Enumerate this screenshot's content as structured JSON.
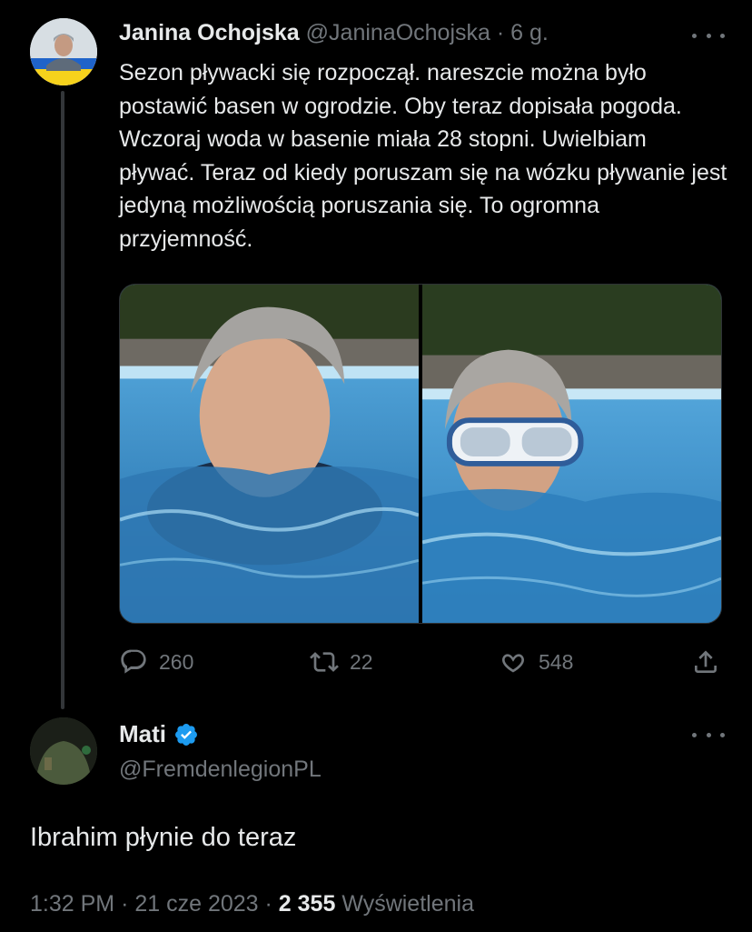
{
  "tweet": {
    "author_name": "Janina Ochojska",
    "author_handle": "@JaninaOchojska",
    "separator": "·",
    "time": "6 g.",
    "text": "Sezon pływacki się rozpoczął. nareszcie można było postawić basen w ogrodzie. Oby teraz dopisała pogoda. Wczoraj woda w basenie miała 28 stopni. Uwielbiam pływać. Teraz od kiedy poruszam się na wózku pływanie jest jedyną możliwością poruszania się. To ogromna przyjemność.",
    "replies": "260",
    "retweets": "22",
    "likes": "548"
  },
  "reply": {
    "author_name": "Mati",
    "author_handle": "@FremdenlegionPL",
    "text": "Ibrahim płynie do teraz",
    "time": "1:32 PM",
    "date": "21 cze 2023",
    "separator": "·",
    "views_count": "2 355",
    "views_label": "Wyświetlenia"
  },
  "icons": {
    "reply": "reply-icon",
    "retweet": "retweet-icon",
    "like": "heart-icon",
    "share": "share-icon",
    "more": "more-icon",
    "verified": "verified-badge-icon"
  },
  "colors": {
    "background": "#000000",
    "text": "#e7e9ea",
    "muted": "#71767b",
    "verified": "#1d9bf0"
  }
}
